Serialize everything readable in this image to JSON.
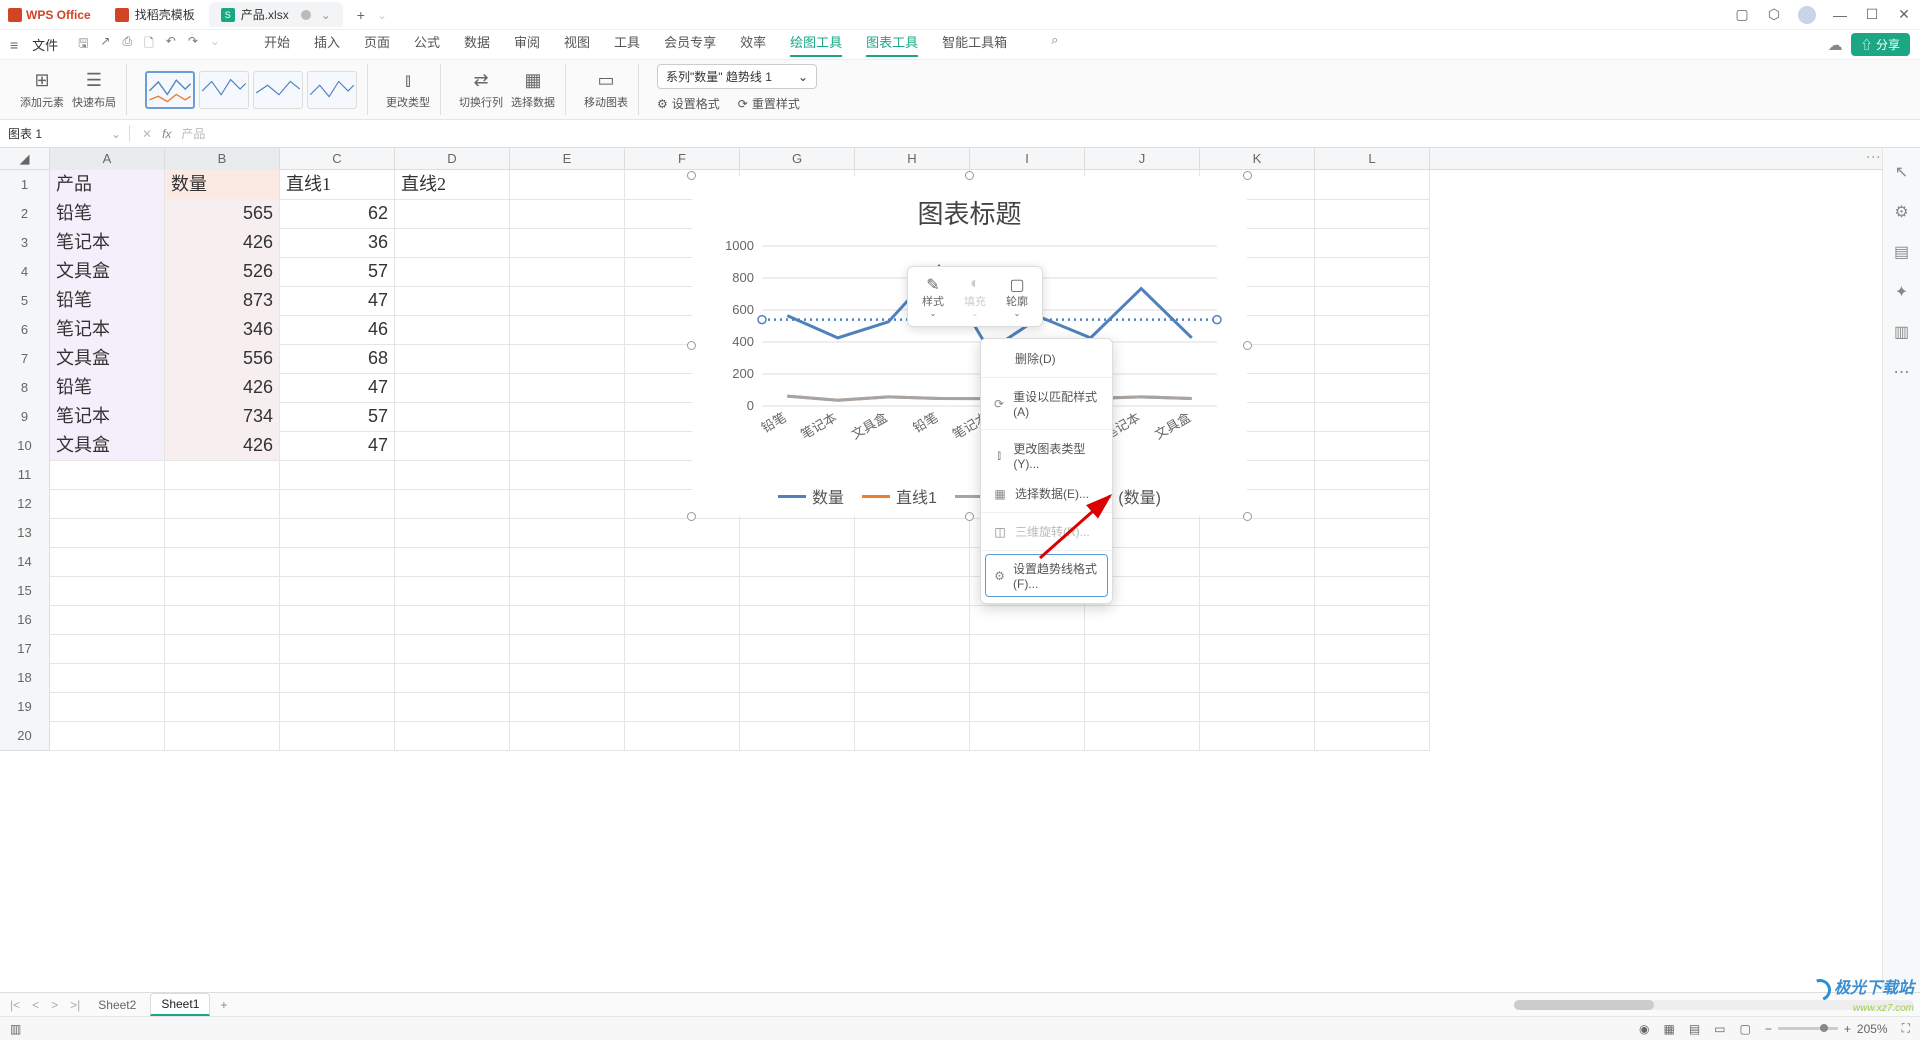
{
  "titlebar": {
    "app_name": "WPS Office",
    "tabs": [
      {
        "label": "找稻壳模板",
        "icon_color": "#d14424"
      },
      {
        "label": "产品.xlsx",
        "icon_color": "#1ba784"
      }
    ],
    "plus": "+",
    "window_controls": {
      "min": "—",
      "max": "☐",
      "close": "✕"
    }
  },
  "menubar": {
    "hamburger": "≡",
    "file": "文件",
    "items": [
      "开始",
      "插入",
      "页面",
      "公式",
      "数据",
      "审阅",
      "视图",
      "工具",
      "会员专享",
      "效率",
      "绘图工具",
      "图表工具",
      "智能工具箱"
    ],
    "green_indices": [
      10,
      11
    ],
    "search_icon": "⌕",
    "cloud_icon": "⌂",
    "share": "⇧ 分享"
  },
  "ribbon": {
    "add_element": "添加元素",
    "quick_layout": "快速布局",
    "change_type": "更改类型",
    "switch_rowcol": "切换行列",
    "select_data": "选择数据",
    "move_chart": "移动图表",
    "selector_text": "系列\"数量\" 趋势线 1",
    "set_format": "设置格式",
    "reset_style": "重置样式"
  },
  "formula": {
    "namebox": "图表 1",
    "fx": "fx",
    "content": "产品"
  },
  "grid": {
    "cols": [
      "A",
      "B",
      "C",
      "D",
      "E",
      "F",
      "G",
      "H",
      "I",
      "J",
      "K",
      "L"
    ],
    "headers": {
      "A": "产品",
      "B": "数量",
      "C": "直线1",
      "D": "直线2"
    },
    "data": [
      {
        "A": "铅笔",
        "B": 565,
        "C": 62
      },
      {
        "A": "笔记本",
        "B": 426,
        "C": 36
      },
      {
        "A": "文具盒",
        "B": 526,
        "C": 57
      },
      {
        "A": "铅笔",
        "B": 873,
        "C": 47
      },
      {
        "A": "笔记本",
        "B": 346,
        "C": 46
      },
      {
        "A": "文具盒",
        "B": 556,
        "C": 68
      },
      {
        "A": "铅笔",
        "B": 426,
        "C": 47
      },
      {
        "A": "笔记本",
        "B": 734,
        "C": 57
      },
      {
        "A": "文具盒",
        "B": 426,
        "C": 47
      }
    ],
    "row_count": 20
  },
  "chart_data": {
    "type": "line",
    "title": "图表标题",
    "categories": [
      "铅笔",
      "笔记本",
      "文具盒",
      "铅笔",
      "笔记本",
      "文具盒",
      "铅笔",
      "笔记本",
      "文具盒"
    ],
    "series": [
      {
        "name": "数量",
        "color": "#4f81bd",
        "values": [
          565,
          426,
          526,
          873,
          346,
          556,
          426,
          734,
          426
        ]
      },
      {
        "name": "直线1",
        "color": "#ed7d31",
        "values": [
          62,
          36,
          57,
          47,
          46,
          68,
          47,
          57,
          47
        ]
      },
      {
        "name": "直线2",
        "color": "#a5a5a5",
        "values": [
          62,
          36,
          57,
          47,
          46,
          68,
          47,
          57,
          47
        ]
      }
    ],
    "trendline": {
      "name": "线性 (数量)",
      "color": "#4f81bd",
      "style": "dotted",
      "slope": 0,
      "intercept": 540
    },
    "ylim": [
      0,
      1000
    ],
    "yticks": [
      0,
      200,
      400,
      600,
      800,
      1000
    ],
    "legend": [
      "数量",
      "直线1",
      "直线2",
      "线性 (数量)"
    ]
  },
  "mini_popup": {
    "style": "样式",
    "fill": "填充",
    "outline": "轮廓"
  },
  "context_menu": {
    "items": [
      {
        "label": "删除(D)",
        "icon": ""
      },
      {
        "label": "重设以匹配样式(A)",
        "icon": "⟳"
      },
      {
        "label": "更改图表类型(Y)...",
        "icon": "⫾"
      },
      {
        "label": "选择数据(E)...",
        "icon": "▦"
      },
      {
        "label": "三维旋转(R)...",
        "icon": "◫",
        "disabled": true
      },
      {
        "label": "设置趋势线格式(F)...",
        "icon": "⚙",
        "highlighted": true
      }
    ]
  },
  "sheets": {
    "tabs": [
      "Sheet2",
      "Sheet1"
    ],
    "active": "Sheet1"
  },
  "statusbar": {
    "ready_icon": "▥",
    "zoom": "205%"
  },
  "watermark": {
    "cn": "极光下载站",
    "url": "www.xz7.com"
  }
}
